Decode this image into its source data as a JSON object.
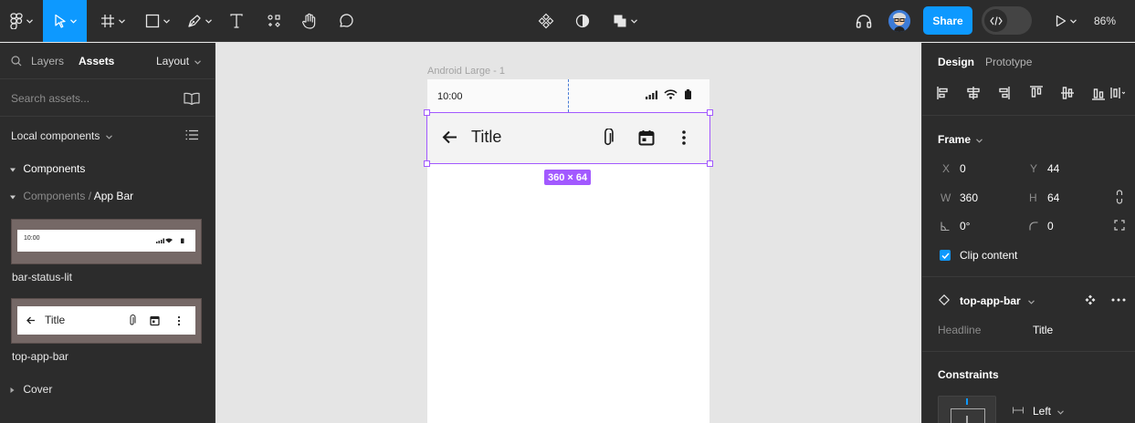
{
  "toolbar": {
    "share_label": "Share",
    "zoom_label": "86%"
  },
  "left_panel": {
    "tab_layers": "Layers",
    "tab_assets": "Assets",
    "layout_label": "Layout",
    "search_placeholder": "Search assets...",
    "local_components": "Local components",
    "components_header": "Components",
    "breadcrumb_parent": "Components",
    "breadcrumb_sep": "/",
    "breadcrumb_current": "App Bar",
    "asset1": {
      "name": "bar-status-lit",
      "time": "10:00"
    },
    "asset2": {
      "name": "top-app-bar",
      "title": "Title"
    },
    "cover_label": "Cover"
  },
  "canvas": {
    "frame_label": "Android Large - 1",
    "status_time": "10:00",
    "appbar_title": "Title",
    "dimension_tag": "360 × 64"
  },
  "right_panel": {
    "tab_design": "Design",
    "tab_prototype": "Prototype",
    "frame_label": "Frame",
    "x_label": "X",
    "x_value": "0",
    "y_label": "Y",
    "y_value": "44",
    "w_label": "W",
    "w_value": "360",
    "h_label": "H",
    "h_value": "64",
    "rotation_value": "0°",
    "radius_value": "0",
    "clip_content": "Clip content",
    "component_name": "top-app-bar",
    "prop_label": "Headline",
    "prop_value": "Title",
    "constraints_label": "Constraints",
    "constraint_h": "Left"
  },
  "colors": {
    "accent": "#0d99ff",
    "selection": "#a259ff",
    "panel_bg": "#2c2c2c",
    "canvas_bg": "#e5e5e5"
  }
}
